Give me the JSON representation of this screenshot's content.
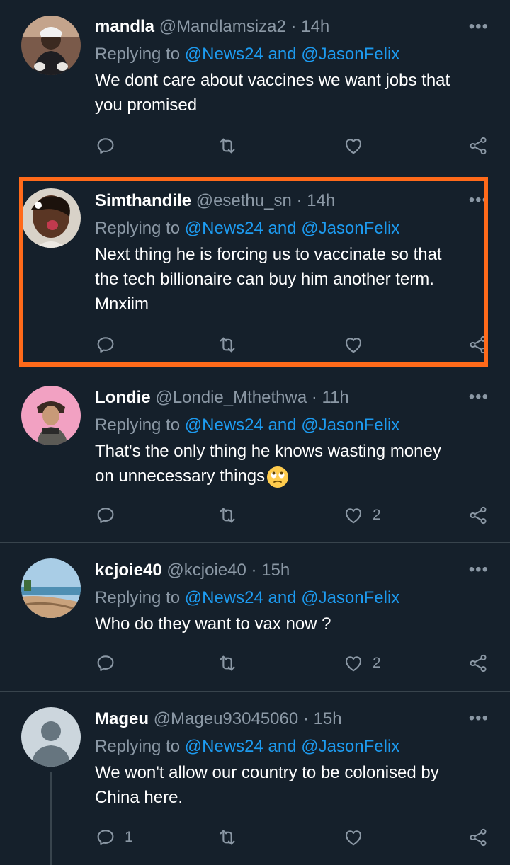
{
  "tweets": [
    {
      "name": "mandla",
      "handle": "@Mandlamsiza2",
      "sep": "·",
      "time": "14h",
      "replying_prefix": "Replying to",
      "mentions": "@News24 and @JasonFelix",
      "text_lines": [
        "We dont care about vaccines we want jobs that",
        "you promised"
      ],
      "reply_count": "",
      "like_count": ""
    },
    {
      "name": "Simthandile",
      "handle": "@esethu_sn",
      "sep": "·",
      "time": "14h",
      "replying_prefix": "Replying to",
      "mentions": "@News24 and @JasonFelix",
      "text_lines": [
        "Next thing he is forcing us to vaccinate so that",
        "the tech billionaire can buy him another term.",
        "Mnxiim"
      ],
      "reply_count": "",
      "like_count": ""
    },
    {
      "name": "Londie",
      "handle": "@Londie_Mthethwa",
      "sep": "·",
      "time": "11h",
      "replying_prefix": "Replying to",
      "mentions": "@News24 and @JasonFelix",
      "text_lines": [
        "That's the only thing he knows wasting money",
        "on unnecessary things"
      ],
      "reply_count": "",
      "like_count": "2"
    },
    {
      "name": "kcjoie40",
      "handle": "@kcjoie40",
      "sep": "·",
      "time": "15h",
      "replying_prefix": "Replying to",
      "mentions": "@News24 and @JasonFelix",
      "text_lines": [
        "Who do they want to vax now ?"
      ],
      "reply_count": "",
      "like_count": "2"
    },
    {
      "name": "Mageu",
      "handle": "@Mageu93045060",
      "sep": "·",
      "time": "15h",
      "replying_prefix": "Replying to",
      "mentions": "@News24 and @JasonFelix",
      "text_lines": [
        "We won't allow our country to be colonised by",
        "China here."
      ],
      "reply_count": "1",
      "like_count": ""
    }
  ],
  "more_glyph": "•••",
  "colors": {
    "background": "#15202b",
    "mention": "#1d9bf0",
    "muted": "#8b98a5",
    "divider": "#38444d",
    "highlight": "#ff6a1a"
  },
  "icons": [
    "reply-icon",
    "retweet-icon",
    "like-icon",
    "share-icon",
    "more-icon",
    "rolling-eyes-emoji"
  ]
}
